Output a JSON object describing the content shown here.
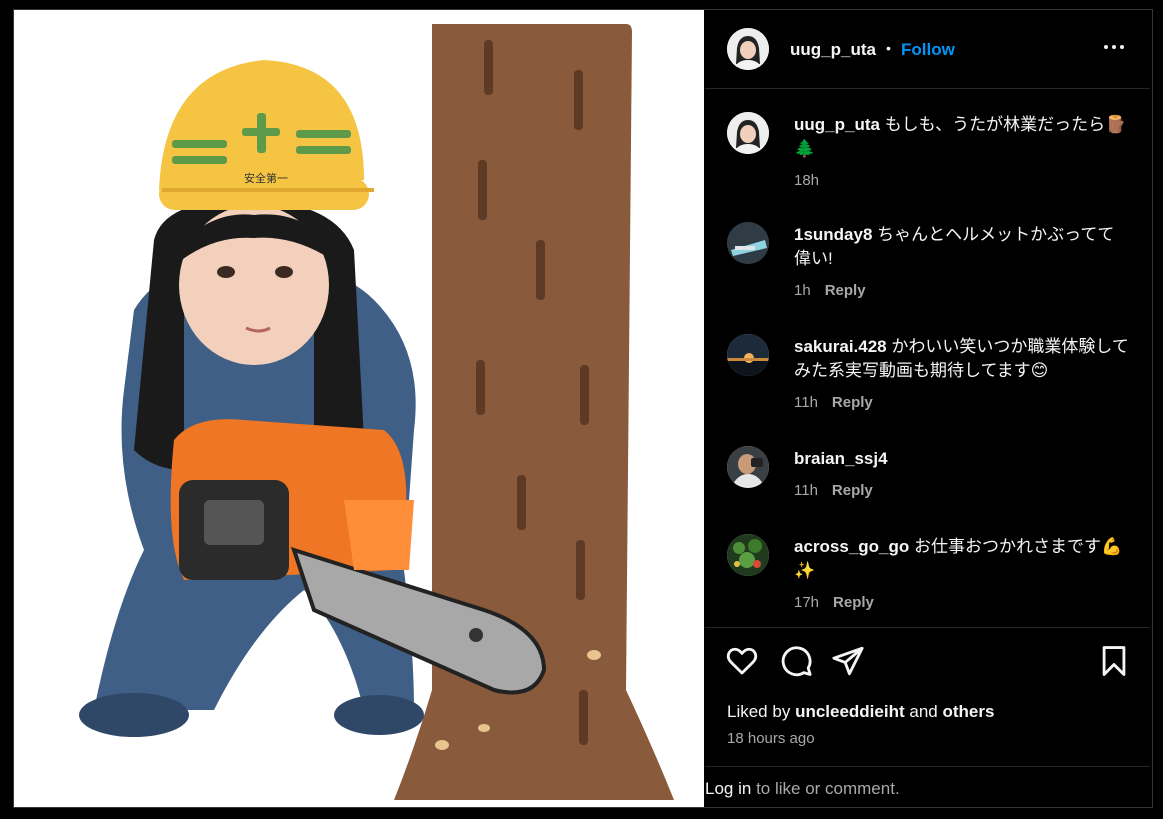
{
  "post": {
    "author": "uug_p_uta",
    "separator": "•",
    "follow_label": "Follow",
    "more_icon": "more-horizontal-icon",
    "helmet_text": "安全第一"
  },
  "comments": [
    {
      "user": "uug_p_uta",
      "text": "もしも、うたが林業だったら🪵🌲",
      "time": "18h",
      "reply": ""
    },
    {
      "user": "1sunday8",
      "text": "ちゃんとヘルメットかぶってて偉い!",
      "time": "1h",
      "reply": "Reply"
    },
    {
      "user": "sakurai.428",
      "text": "かわいい笑いつか職業体験してみた系実写動画も期待してます😊",
      "time": "11h",
      "reply": "Reply"
    },
    {
      "user": "braian_ssj4",
      "text": "",
      "time": "11h",
      "reply": "Reply"
    },
    {
      "user": "across_go_go",
      "text": "お仕事おつかれさまです💪✨",
      "time": "17h",
      "reply": "Reply"
    }
  ],
  "actions": {
    "icons": [
      "heart-icon",
      "comment-icon",
      "share-icon",
      "bookmark-icon"
    ],
    "liked_prefix": "Liked by",
    "liked_user": "uncleeddieiht",
    "liked_and": "and",
    "liked_others": "others",
    "time_ago": "18 hours ago"
  },
  "login": {
    "link": "Log in",
    "rest": "to like or comment."
  },
  "colors": {
    "background": "#000000",
    "accent": "#0095f6",
    "muted": "#a8a8a8",
    "border": "#262626"
  }
}
